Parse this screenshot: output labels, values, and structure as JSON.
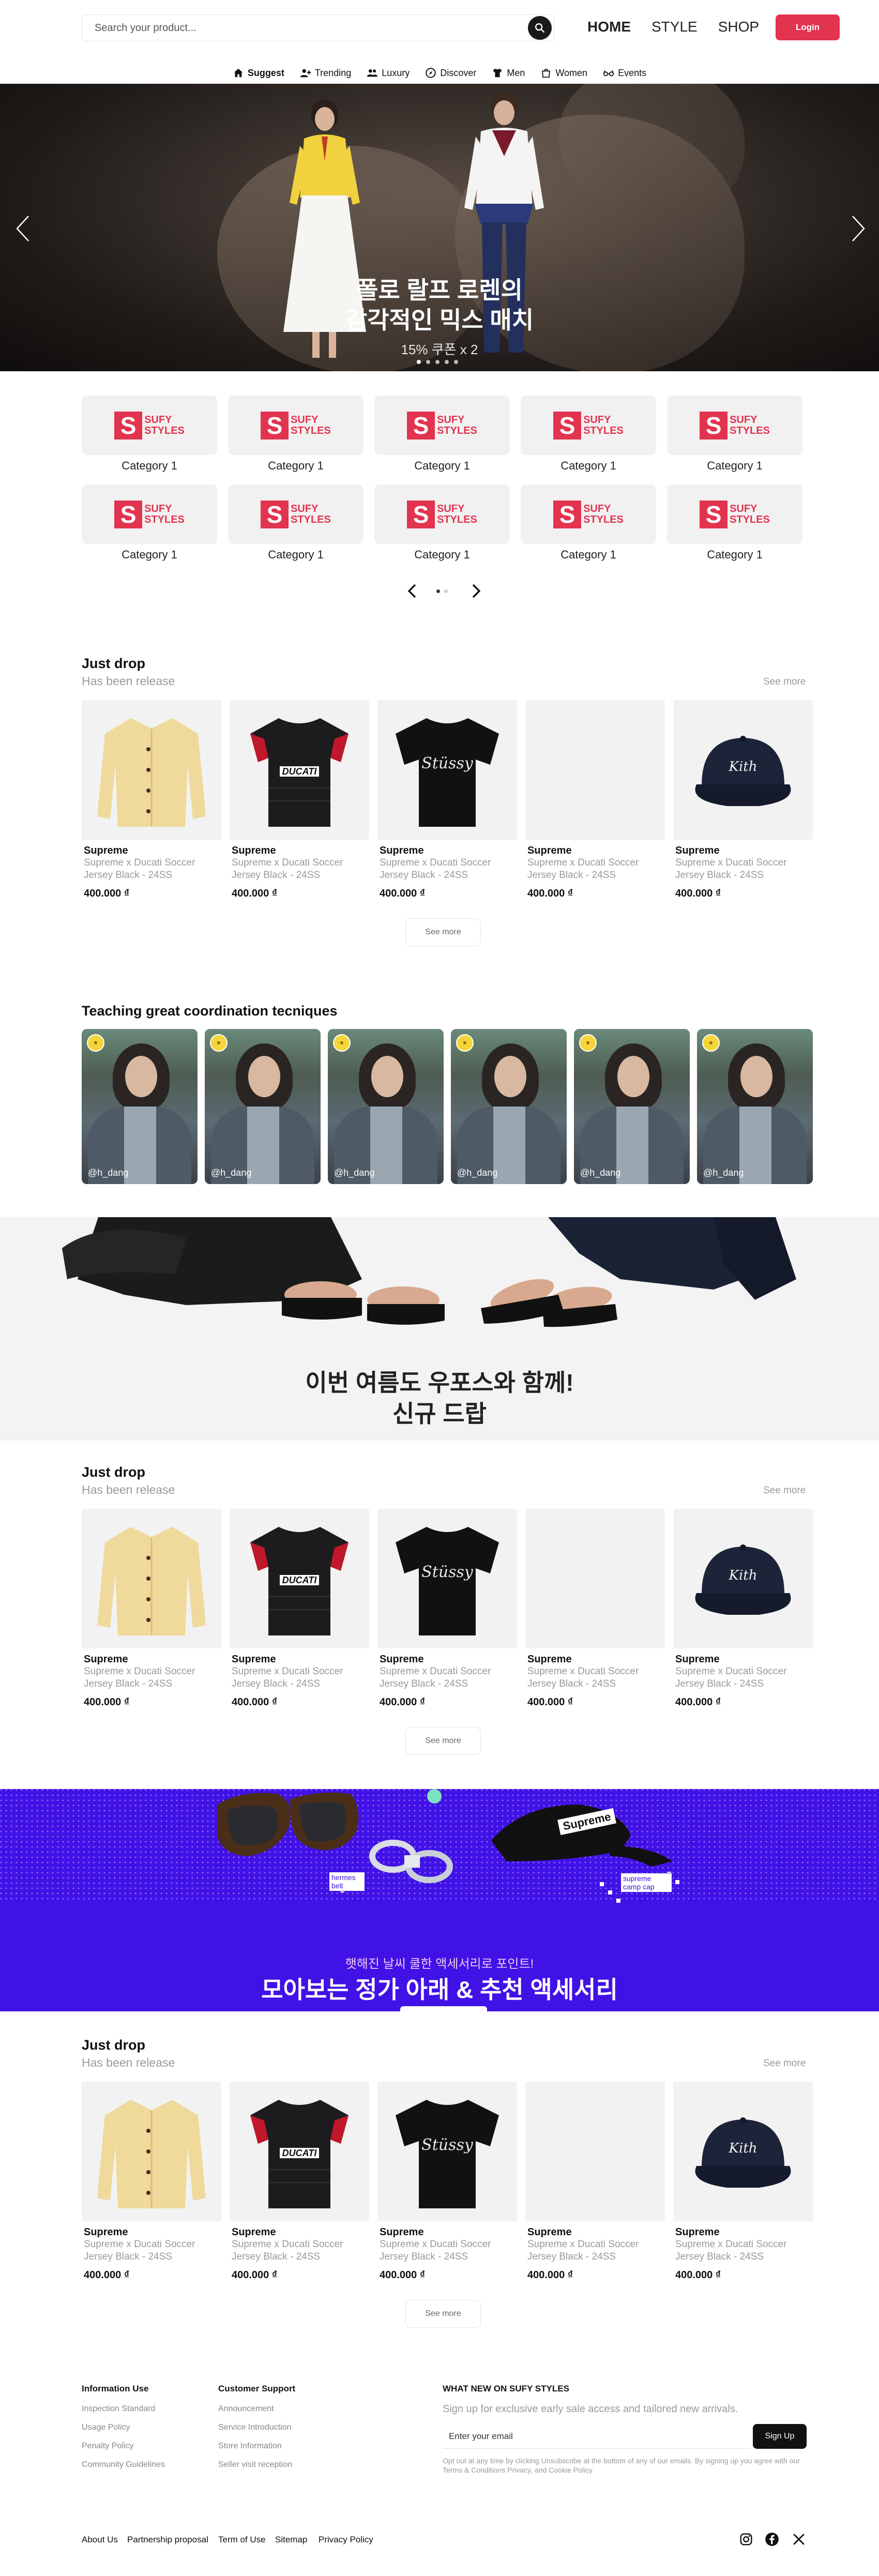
{
  "header": {
    "search_placeholder": "Search your product...",
    "nav": [
      "HOME",
      "STYLE",
      "SHOP"
    ],
    "login_label": "Login"
  },
  "category_nav": [
    {
      "label": "Suggest",
      "icon": "home-icon"
    },
    {
      "label": "Trending",
      "icon": "user-plus-icon"
    },
    {
      "label": "Luxury",
      "icon": "users-icon"
    },
    {
      "label": "Discover",
      "icon": "compass-icon"
    },
    {
      "label": "Men",
      "icon": "tshirt-icon"
    },
    {
      "label": "Women",
      "icon": "bag-icon"
    },
    {
      "label": "Events",
      "icon": "glasses-icon"
    }
  ],
  "hero": {
    "title": "폴로 랄프 로렌의\n감각적인 믹스 매치",
    "subtitle": "15% 쿠폰 x 2",
    "slide_count": 5,
    "active_slide": 1
  },
  "categories": {
    "logo_top": "SUFY",
    "logo_bottom": "STYLES",
    "items": [
      "Category 1",
      "Category 1",
      "Category 1",
      "Category 1",
      "Category 1",
      "Category 1",
      "Category 1",
      "Category 1",
      "Category 1",
      "Category 1"
    ]
  },
  "product_sections": [
    {
      "title": "Just drop",
      "subtitle": "Has been release",
      "see_more_link": "See more",
      "see_more_button": "See more",
      "products": [
        {
          "brand": "Supreme",
          "name": "Supreme x Ducati Soccer Jersey Black - 24SS",
          "price": "400.000 ₫",
          "image": "cardigan"
        },
        {
          "brand": "Supreme",
          "name": "Supreme x Ducati Soccer Jersey Black - 24SS",
          "price": "400.000 ₫",
          "image": "jersey"
        },
        {
          "brand": "Supreme",
          "name": "Supreme x Ducati Soccer Jersey Black - 24SS",
          "price": "400.000 ₫",
          "image": "tshirt"
        },
        {
          "brand": "Supreme",
          "name": "Supreme x Ducati Soccer Jersey Black - 24SS",
          "price": "400.000 ₫",
          "image": "empty"
        },
        {
          "brand": "Supreme",
          "name": "Supreme x Ducati Soccer Jersey Black - 24SS",
          "price": "400.000 ₫",
          "image": "cap"
        }
      ]
    },
    {
      "title": "Just drop",
      "subtitle": "Has been release",
      "see_more_link": "See more",
      "see_more_button": "See more",
      "products": [
        {
          "brand": "Supreme",
          "name": "Supreme x Ducati Soccer Jersey Black - 24SS",
          "price": "400.000 ₫",
          "image": "cardigan"
        },
        {
          "brand": "Supreme",
          "name": "Supreme x Ducati Soccer Jersey Black - 24SS",
          "price": "400.000 ₫",
          "image": "jersey"
        },
        {
          "brand": "Supreme",
          "name": "Supreme x Ducati Soccer Jersey Black - 24SS",
          "price": "400.000 ₫",
          "image": "tshirt"
        },
        {
          "brand": "Supreme",
          "name": "Supreme x Ducati Soccer Jersey Black - 24SS",
          "price": "400.000 ₫",
          "image": "empty"
        },
        {
          "brand": "Supreme",
          "name": "Supreme x Ducati Soccer Jersey Black - 24SS",
          "price": "400.000 ₫",
          "image": "cap"
        }
      ]
    },
    {
      "title": "Just drop",
      "subtitle": "Has been release",
      "see_more_link": "See more",
      "see_more_button": "See more",
      "products": [
        {
          "brand": "Supreme",
          "name": "Supreme x Ducati Soccer Jersey Black - 24SS",
          "price": "400.000 ₫",
          "image": "cardigan"
        },
        {
          "brand": "Supreme",
          "name": "Supreme x Ducati Soccer Jersey Black - 24SS",
          "price": "400.000 ₫",
          "image": "jersey"
        },
        {
          "brand": "Supreme",
          "name": "Supreme x Ducati Soccer Jersey Black - 24SS",
          "price": "400.000 ₫",
          "image": "tshirt"
        },
        {
          "brand": "Supreme",
          "name": "Supreme x Ducati Soccer Jersey Black - 24SS",
          "price": "400.000 ₫",
          "image": "empty"
        },
        {
          "brand": "Supreme",
          "name": "Supreme x Ducati Soccer Jersey Black - 24SS",
          "price": "400.000 ₫",
          "image": "cap"
        }
      ]
    }
  ],
  "coordination": {
    "title": "Teaching great coordination tecniques",
    "items": [
      {
        "handle": "@h_dang"
      },
      {
        "handle": "@h_dang"
      },
      {
        "handle": "@h_dang"
      },
      {
        "handle": "@h_dang"
      },
      {
        "handle": "@h_dang"
      },
      {
        "handle": "@h_dang"
      }
    ]
  },
  "sandal_banner": {
    "title": "이번 여름도 우포스와 함께!\n신규 드랍"
  },
  "accessory_banner": {
    "small_title": "햇해진 날씨 쿨한 액세서리로 포인트!",
    "title": "모아보는 정가 아래 & 추천 액세서리",
    "tag_left": "hermes\nbelt",
    "tag_right": "supreme\ncamp cap",
    "cap_logo": "Supreme"
  },
  "footer": {
    "info_title": "Information Use",
    "info_links": [
      "Inspection Standard",
      "Usage Policy",
      "Penalty Policy",
      "Community Guidelines"
    ],
    "support_title": "Customer Support",
    "support_links": [
      "Announcement",
      "Service Introduction",
      "Store Information",
      "Seller visit reception"
    ],
    "newsletter_title": "WHAT NEW ON SUFY STYLES",
    "newsletter_sub": "Sign up for exclusive early sale access and tailored new arrivals.",
    "email_placeholder": "Enter your email",
    "signup_label": "Sign Up",
    "newsletter_note": "Opt out at any time by clicking Unsubscribe at the bottom of any of our emails. By signing up you agree with our Terms & Conditions Privacy, and Cookie Policy",
    "bottom_links": [
      "About Us",
      "Partnership proposal",
      "Term of Use",
      "Sitemap",
      "Privacy Policy"
    ],
    "social": [
      "instagram-icon",
      "facebook-icon",
      "x-icon"
    ]
  },
  "colors": {
    "accent": "#e2334f",
    "accessory_banner": "#4012e6",
    "muted_text": "#9a9a9a"
  }
}
